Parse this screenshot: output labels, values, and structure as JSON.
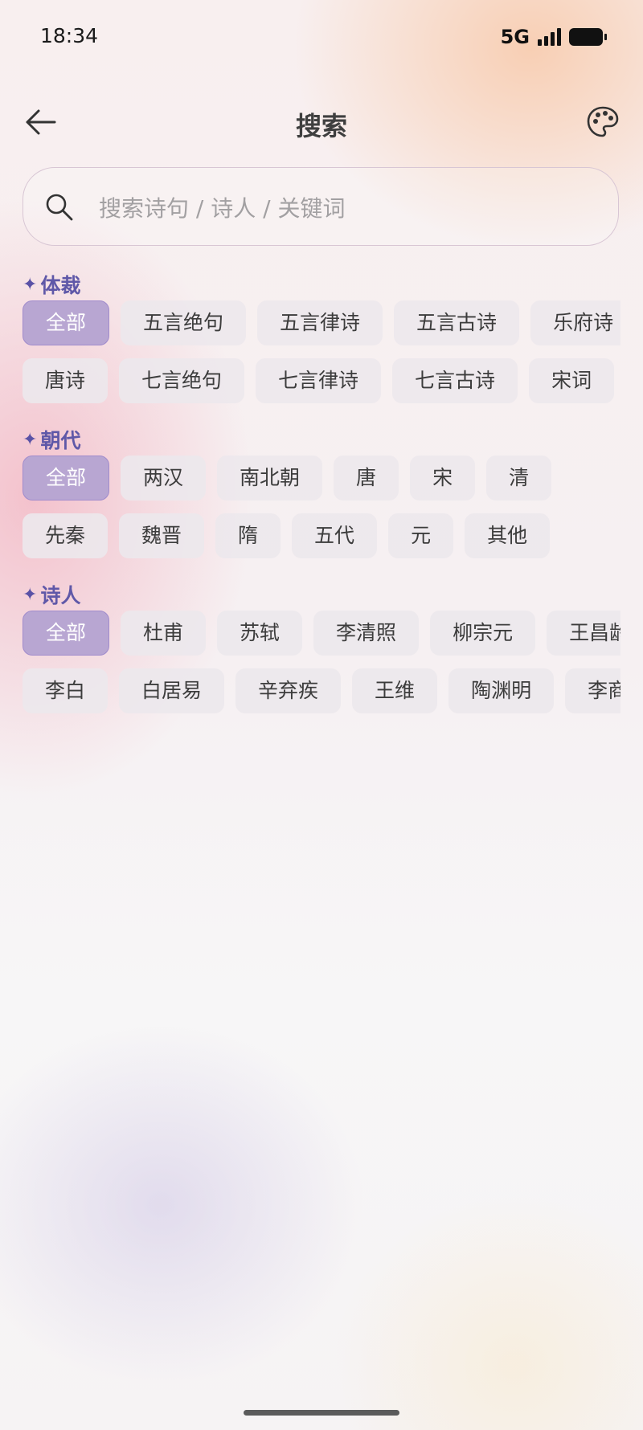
{
  "status_bar": {
    "time": "18:34",
    "network": "5G",
    "signal_level": 4,
    "battery_level": 1.0
  },
  "header": {
    "title": "搜索",
    "back_icon": "arrow-left-icon",
    "palette_icon": "palette-icon"
  },
  "search": {
    "placeholder": "搜索诗句 / 诗人 / 关键词",
    "value": ""
  },
  "sections": {
    "genre": {
      "title": "体裁",
      "row1": [
        "全部",
        "五言绝句",
        "五言律诗",
        "五言古诗",
        "乐府诗"
      ],
      "row2": [
        "唐诗",
        "七言绝句",
        "七言律诗",
        "七言古诗",
        "宋词"
      ],
      "selected": "全部"
    },
    "dynasty": {
      "title": "朝代",
      "row1": [
        "全部",
        "两汉",
        "南北朝",
        "唐",
        "宋",
        "清"
      ],
      "row2": [
        "先秦",
        "魏晋",
        "隋",
        "五代",
        "元",
        "其他"
      ],
      "selected": "全部"
    },
    "poet": {
      "title": "诗人",
      "row1": [
        "全部",
        "杜甫",
        "苏轼",
        "李清照",
        "柳宗元",
        "王昌龄"
      ],
      "row2": [
        "李白",
        "白居易",
        "辛弃疾",
        "王维",
        "陶渊明",
        "李商隐"
      ],
      "selected": "全部"
    }
  },
  "colors": {
    "accent": "#5f58a8",
    "chip_active_bg": "#b8a6d2",
    "chip_bg": "#ece8ec"
  }
}
